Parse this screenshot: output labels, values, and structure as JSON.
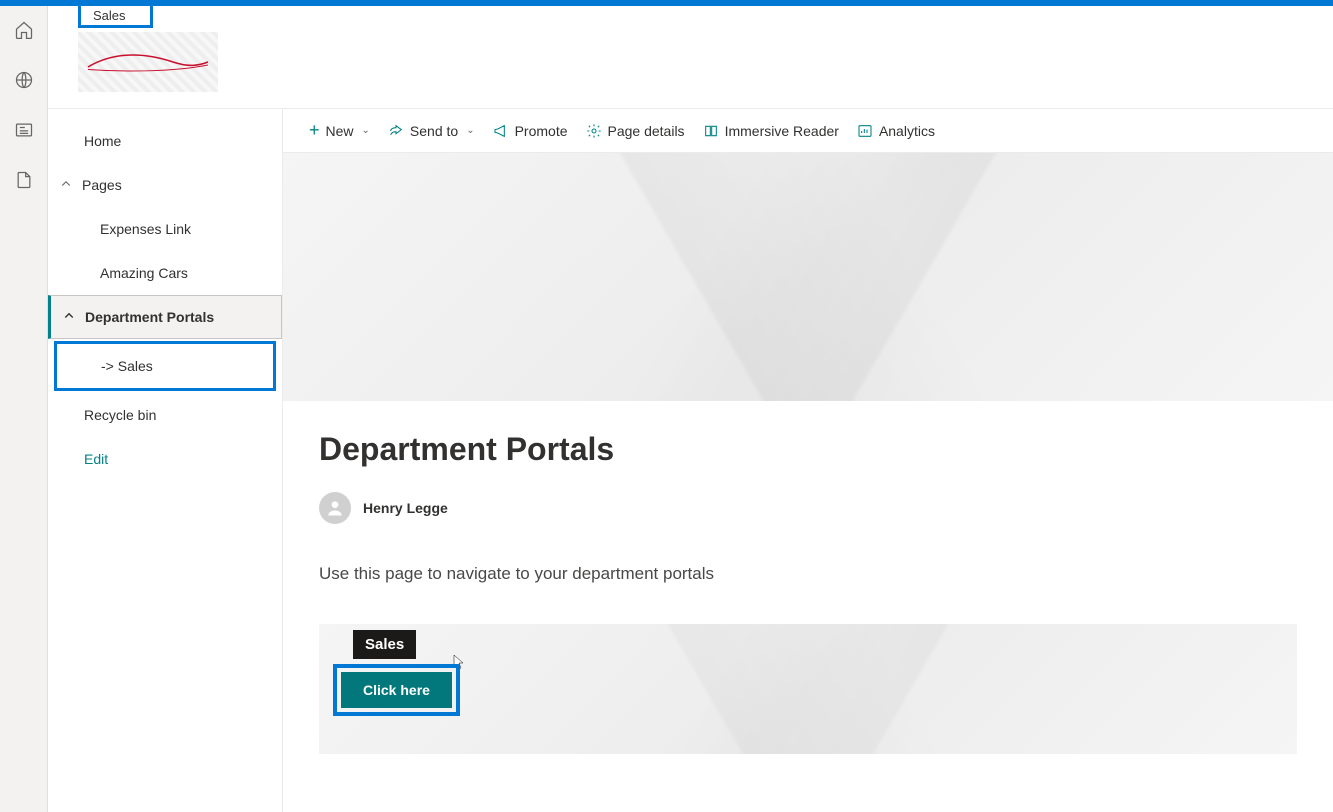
{
  "header": {
    "sales_tab": "Sales"
  },
  "rail": {
    "home": "home-icon",
    "globe": "globe-icon",
    "news": "news-icon",
    "file": "file-icon"
  },
  "nav": {
    "home": "Home",
    "pages": "Pages",
    "expenses": "Expenses Link",
    "amazing": "Amazing Cars",
    "dept": "Department Portals",
    "sales": "-> Sales",
    "recycle": "Recycle bin",
    "edit": "Edit"
  },
  "cmdbar": {
    "new": "New",
    "sendto": "Send to",
    "promote": "Promote",
    "details": "Page details",
    "immersive": "Immersive Reader",
    "analytics": "Analytics"
  },
  "page": {
    "title": "Department Portals",
    "author": "Henry Legge",
    "desc": "Use this page to navigate to your department portals",
    "tile": {
      "tooltip": "Sales",
      "button": "Click here"
    }
  }
}
